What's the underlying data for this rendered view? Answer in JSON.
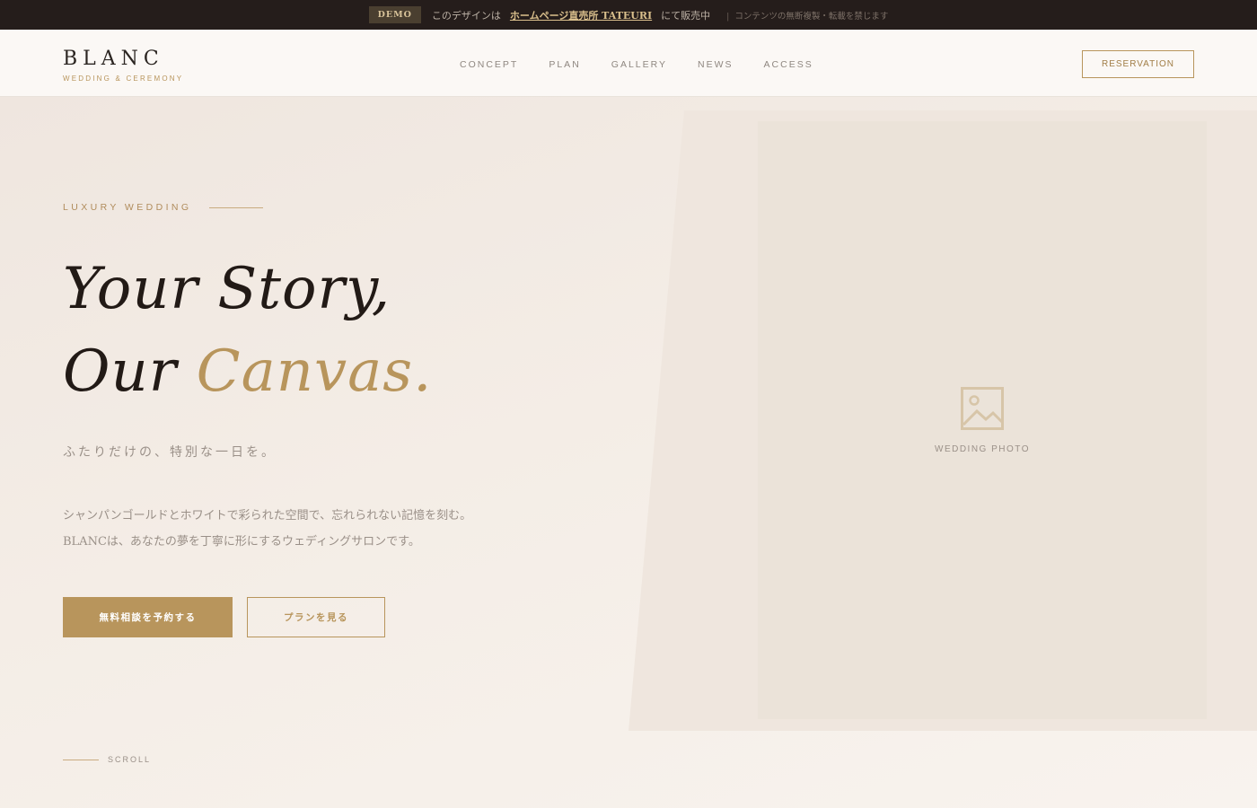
{
  "demo_bar": {
    "badge": "DEMO",
    "text": "このデザインは",
    "link": "ホームページ直売所 TATEURI",
    "suffix": "にて販売中",
    "note": "コンテンツの無断複製・転載を禁じます"
  },
  "header": {
    "logo_title": "BLANC",
    "logo_subtitle": "WEDDING & CEREMONY",
    "nav": [
      "CONCEPT",
      "PLAN",
      "GALLERY",
      "NEWS",
      "ACCESS"
    ],
    "reservation_label": "RESERVATION"
  },
  "hero": {
    "eyebrow": "LUXURY WEDDING",
    "headline_line1": "Your Story,",
    "headline_line2_prefix": "Our ",
    "headline_line2_accent": "Canvas.",
    "tagline": "ふたりだけの、特別な一日を。",
    "lead": "シャンパンゴールドとホワイトで彩られた空間で、忘れられない記憶を刻む。BLANCは、あなたの夢を丁寧に形にするウェディングサロンです。",
    "primary_cta": "無料相談を予約する",
    "secondary_cta": "プランを見る",
    "scroll_label": "SCROLL",
    "photo_label": "WEDDING PHOTO"
  },
  "colors": {
    "gold": "#b8955c",
    "dark": "#251d1b",
    "background": "#f3ebe4"
  }
}
